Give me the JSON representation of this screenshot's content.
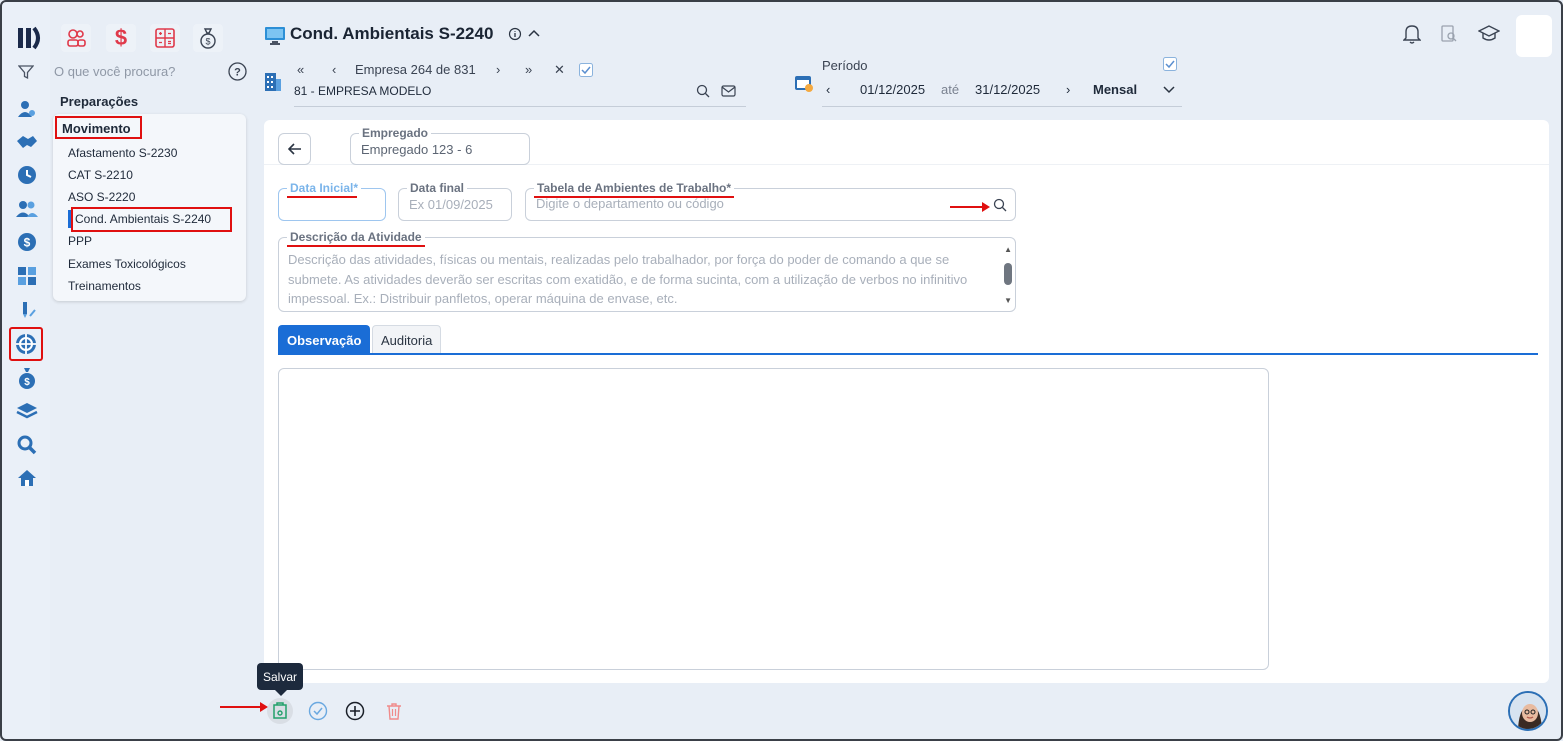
{
  "header": {
    "title": "Cond. Ambientais S-2240",
    "search_placeholder": "O que você procura?"
  },
  "empresa": {
    "nav_label": "Empresa 264 de 831",
    "selected": "81 - EMPRESA MODELO"
  },
  "periodo": {
    "label": "Período",
    "start": "01/12/2025",
    "separator": "até",
    "end": "31/12/2025",
    "mode": "Mensal"
  },
  "nav": {
    "section1": "Preparações",
    "section2": "Movimento",
    "items": [
      {
        "label": "Afastamento S-2230"
      },
      {
        "label": "CAT S-2210"
      },
      {
        "label": "ASO S-2220"
      },
      {
        "label": "Cond. Ambientais S-2240"
      },
      {
        "label": "PPP"
      },
      {
        "label": "Exames Toxicológicos"
      },
      {
        "label": "Treinamentos"
      }
    ]
  },
  "form": {
    "empregado_label": "Empregado",
    "empregado_value": "Empregado 123 - 6",
    "data_inicial_label": "Data Inicial*",
    "data_final_label": "Data final",
    "data_final_placeholder": "Ex 01/09/2025",
    "tabela_label": "Tabela de Ambientes de Trabalho*",
    "tabela_placeholder": "Digite o departamento ou código",
    "descricao_label": "Descrição da Atividade",
    "descricao_placeholder": "Descrição das atividades, físicas ou mentais, realizadas pelo trabalhador, por força do poder de comando a que se submete. As atividades deverão ser escritas com exatidão, e de forma sucinta, com a utilização de verbos no infinitivo impessoal. Ex.: Distribuir panfletos, operar máquina de envase, etc."
  },
  "tabs": [
    {
      "label": "Observação",
      "active": true
    },
    {
      "label": "Auditoria",
      "active": false
    }
  ],
  "toolbar": {
    "tooltip": "Salvar"
  },
  "colors": {
    "accent": "#1a6dd6",
    "highlight": "#e01010",
    "save_green": "#22a06b",
    "delete_red": "#f08a8a"
  }
}
